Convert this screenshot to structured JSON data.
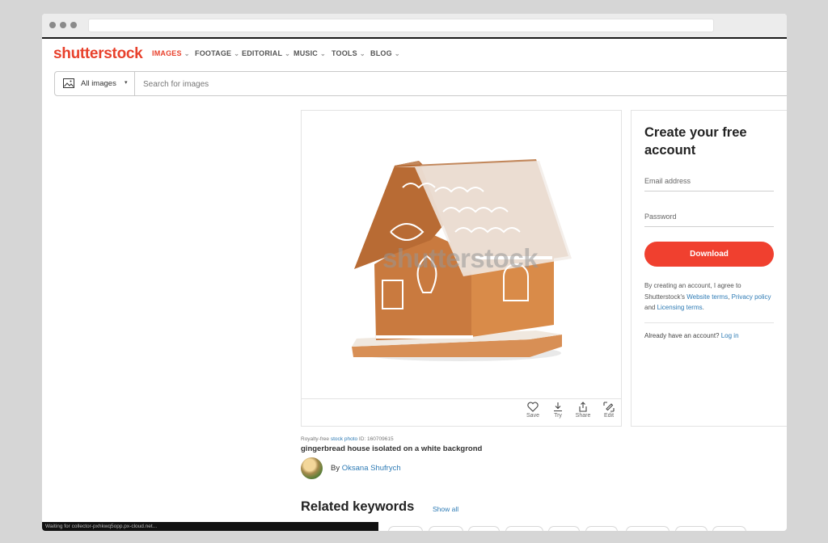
{
  "brand": {
    "logo": "shutterstock",
    "accent": "#e8412c"
  },
  "nav": {
    "items": [
      {
        "label": "IMAGES",
        "active": true
      },
      {
        "label": "FOOTAGE"
      },
      {
        "label": "EDITORIAL"
      },
      {
        "label": "MUSIC"
      },
      {
        "label": "TOOLS"
      },
      {
        "label": "BLOG"
      }
    ]
  },
  "search": {
    "type_label": "All images",
    "placeholder": "Search for images",
    "type_icon": "image-icon"
  },
  "image": {
    "watermark": "shutterstock",
    "alt": "gingerbread house isolated on a white backgrond",
    "actions": [
      {
        "label": "Save",
        "icon": "heart-icon"
      },
      {
        "label": "Try",
        "icon": "download-icon"
      },
      {
        "label": "Share",
        "icon": "share-icon"
      },
      {
        "label": "Edit",
        "icon": "edit-icon"
      }
    ]
  },
  "meta": {
    "prefix": "Royalty-free ",
    "link": "stock photo",
    "id_text": " ID: 160709615",
    "title": "gingerbread house isolated on a white backgrond",
    "by": "By ",
    "author": "Oksana Shufrych"
  },
  "signup": {
    "title": "Create your free account",
    "email_placeholder": "Email address",
    "password_placeholder": "Password",
    "button": "Download",
    "terms_1": "By creating an account, I agree to Shutterstock's ",
    "terms_link_1": "Website terms",
    "terms_2": ", ",
    "terms_link_2": "Privacy policy",
    "terms_3": " and ",
    "terms_link_3": "Licensing terms",
    "terms_4": ".",
    "login_prompt": "Already have an account? ",
    "login_link": "Log in"
  },
  "related": {
    "title": "Related keywords",
    "show_all": "Show all"
  },
  "status_bar": "Waiting for collector-pxhkwq5opp.px-cloud.net..."
}
